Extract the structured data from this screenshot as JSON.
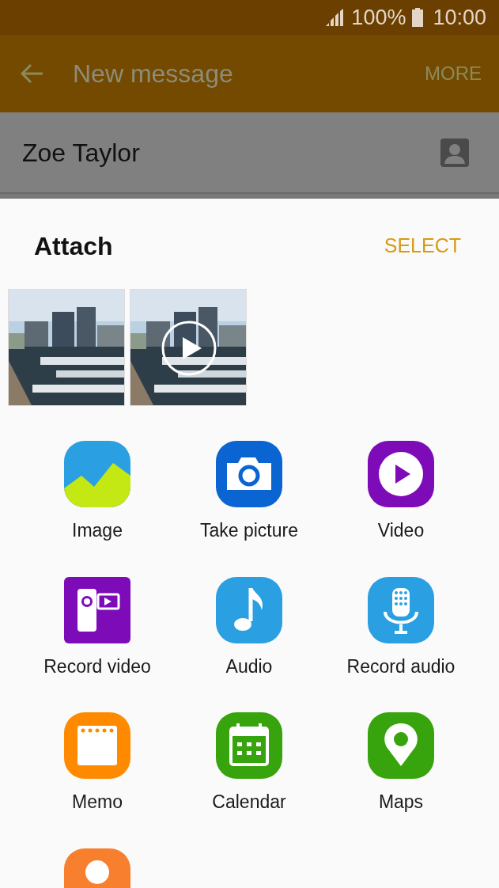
{
  "status_bar": {
    "battery": "100%",
    "time": "10:00"
  },
  "app_bar": {
    "title": "New message",
    "action": "MORE"
  },
  "recipient": {
    "name": "Zoe Taylor"
  },
  "attach": {
    "title": "Attach",
    "action": "SELECT",
    "thumbnails": [
      {
        "kind": "picture",
        "video": false
      },
      {
        "kind": "picture",
        "video": true
      }
    ],
    "items": [
      {
        "label": "Image"
      },
      {
        "kind": "camera",
        "label": "Take picture"
      },
      {
        "kind": "video",
        "label": "Video"
      },
      {
        "kind": "record_video",
        "label": "Record video"
      },
      {
        "kind": "audio",
        "label": "Audio"
      },
      {
        "kind": "record_audio",
        "label": "Record audio"
      },
      {
        "kind": "memo",
        "label": "Memo"
      },
      {
        "kind": "calendar",
        "label": "Calendar"
      },
      {
        "kind": "maps",
        "label": "Maps"
      },
      {
        "kind": "contact"
      }
    ]
  }
}
